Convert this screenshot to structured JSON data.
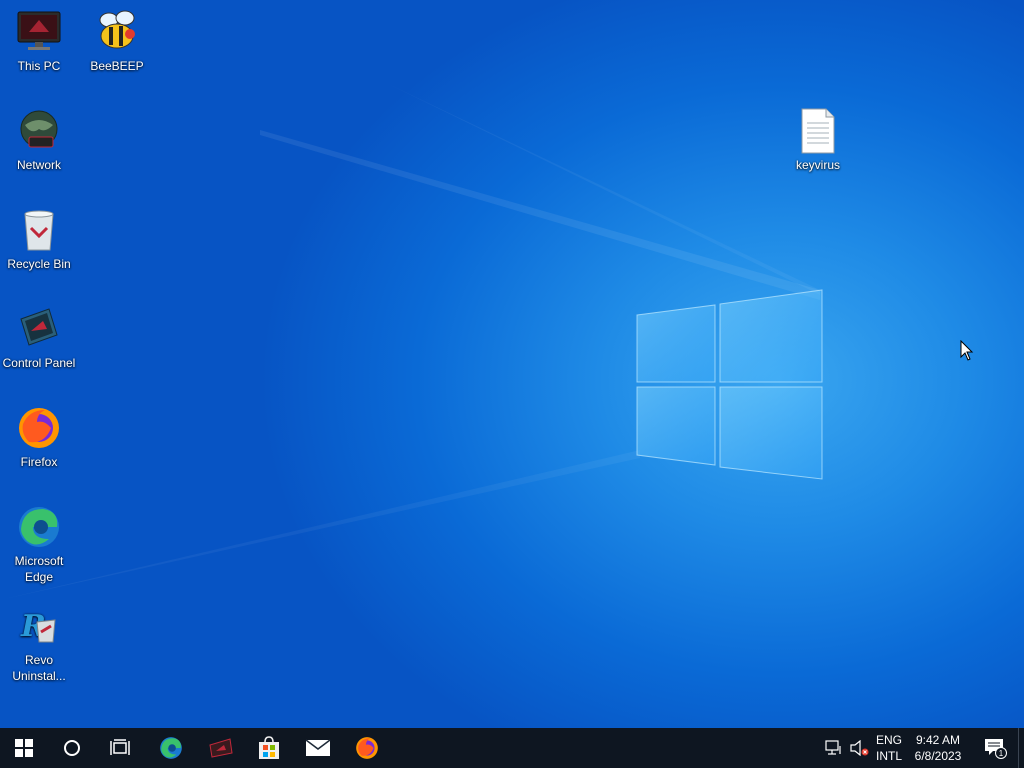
{
  "desktop": {
    "icons": [
      {
        "label": "This PC",
        "icon": "this-pc-icon"
      },
      {
        "label": "BeeBEEP",
        "icon": "beebeep-icon"
      },
      {
        "label": "Network",
        "icon": "network-icon"
      },
      {
        "label": "Recycle Bin",
        "icon": "recycle-bin-icon"
      },
      {
        "label": "Control Panel",
        "icon": "control-panel-icon"
      },
      {
        "label": "Firefox",
        "icon": "firefox-icon"
      },
      {
        "label": "Microsoft Edge",
        "icon": "edge-icon"
      },
      {
        "label": "Revo Uninstal...",
        "icon": "revo-uninstaller-icon"
      },
      {
        "label": "keyvirus",
        "icon": "text-file-icon"
      }
    ]
  },
  "taskbar": {
    "pinned": [
      "start-icon",
      "search-icon",
      "task-view-icon",
      "edge-icon",
      "rog-app-icon",
      "store-icon",
      "mail-icon",
      "firefox-icon"
    ],
    "tray": {
      "lang_line1": "ENG",
      "lang_line2": "INTL",
      "time": "9:42 AM",
      "date": "6/8/2023",
      "notification_count": "1"
    }
  },
  "colors": {
    "taskbar": "#0e1621",
    "accent": "#0a6ad6"
  }
}
